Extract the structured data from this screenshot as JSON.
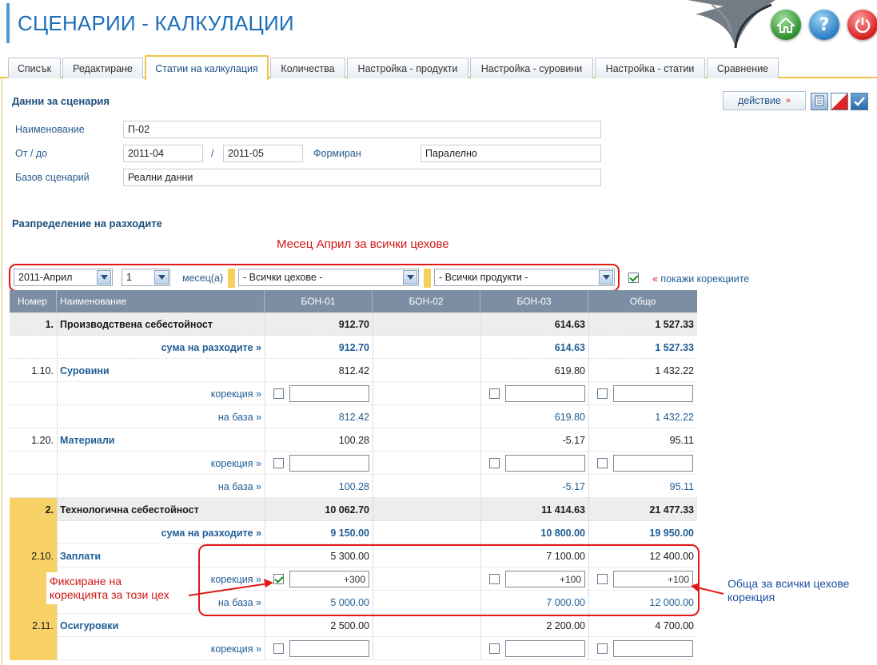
{
  "header": {
    "title": "СЦЕНАРИИ - КАЛКУЛАЦИИ",
    "buttons": [
      "home-icon",
      "help-icon",
      "power-icon"
    ]
  },
  "tabs": [
    {
      "label": "Списък",
      "active": false
    },
    {
      "label": "Редактиране",
      "active": false
    },
    {
      "label": "Статии на калкулация",
      "active": true
    },
    {
      "label": "Количества",
      "active": false
    },
    {
      "label": "Настройка - продукти",
      "active": false
    },
    {
      "label": "Настройка - суровини",
      "active": false
    },
    {
      "label": "Настройка - статии",
      "active": false
    },
    {
      "label": "Сравнение",
      "active": false
    }
  ],
  "scenario": {
    "section_title": "Данни за сценария",
    "action_label": "действие",
    "action_arrows": "»",
    "name_label": "Наименование",
    "name_value": "П-02",
    "period_label": "От / до",
    "from_value": "2011-04",
    "separator": "/",
    "to_value": "2011-05",
    "formed_label": "Формиран",
    "formed_value": "Паралелно",
    "base_label": "Базов сценарий",
    "base_value": "Реални данни"
  },
  "distribution": {
    "section_title": "Разпределение на разходите",
    "annotation_top": "Месец Април за всички цехове",
    "month_select": "2011-Април",
    "count_select": "1",
    "months_label": "месец(а)",
    "workshop_select": "- Всички цехове -",
    "product_select": "- Всички продукти -",
    "show_corrections_checked": true,
    "show_corrections_label": "« покажи корекциите"
  },
  "table": {
    "columns": [
      "Номер",
      "Наименование",
      "БОН-01",
      "БОН-02",
      "БОН-03",
      "Общо"
    ],
    "rows": [
      {
        "type": "group",
        "num": "1.",
        "name": "Производствена себестойност",
        "c1": "912.70",
        "c2": "",
        "c3": "614.63",
        "total": "1 527.33"
      },
      {
        "type": "sum",
        "num": "",
        "name": "сума на разходите »",
        "c1": "912.70",
        "c2": "",
        "c3": "614.63",
        "total": "1 527.33"
      },
      {
        "type": "item",
        "num": "1.10.",
        "name": "Суровини",
        "c1": "812.42",
        "c2": "",
        "c3": "619.80",
        "total": "1 432.22"
      },
      {
        "type": "corr",
        "num": "",
        "name": "корекция »",
        "c1": "",
        "c1_checked": false,
        "c3": "",
        "c3_checked": false,
        "total": "",
        "total_checked": false
      },
      {
        "type": "base",
        "num": "",
        "name": "на база »",
        "c1": "812.42",
        "c2": "",
        "c3": "619.80",
        "total": "1 432.22"
      },
      {
        "type": "item",
        "num": "1.20.",
        "name": "Материали",
        "c1": "100.28",
        "c2": "",
        "c3": "-5.17",
        "total": "95.11"
      },
      {
        "type": "corr",
        "num": "",
        "name": "корекция »",
        "c1": "",
        "c1_checked": false,
        "c3": "",
        "c3_checked": false,
        "total": "",
        "total_checked": false
      },
      {
        "type": "base",
        "num": "",
        "name": "на база »",
        "c1": "100.28",
        "c2": "",
        "c3": "-5.17",
        "total": "95.11"
      },
      {
        "type": "group",
        "num": "2.",
        "name": "Технологична себестойност",
        "c1": "10 062.70",
        "c2": "",
        "c3": "11 414.63",
        "total": "21 477.33"
      },
      {
        "type": "sum",
        "num": "",
        "name": "сума на разходите »",
        "c1": "9 150.00",
        "c2": "",
        "c3": "10 800.00",
        "total": "19 950.00"
      },
      {
        "type": "item",
        "num": "2.10.",
        "name": "Заплати",
        "c1": "5 300.00",
        "c2": "",
        "c3": "7 100.00",
        "total": "12 400.00"
      },
      {
        "type": "corr",
        "num": "",
        "name": "корекция »",
        "c1": "+300",
        "c1_checked": true,
        "c3": "+100",
        "c3_checked": false,
        "total": "+100",
        "total_checked": false
      },
      {
        "type": "base",
        "num": "",
        "name": "на база »",
        "c1": "5 000.00",
        "c2": "",
        "c3": "7 000.00",
        "total": "12 000.00"
      },
      {
        "type": "item",
        "num": "2.11.",
        "name": "Осигуровки",
        "c1": "2 500.00",
        "c2": "",
        "c3": "2 200.00",
        "total": "4 700.00"
      },
      {
        "type": "corr",
        "num": "",
        "name": "корекция »",
        "c1": "",
        "c1_checked": false,
        "c3": "",
        "c3_checked": false,
        "total": "",
        "total_checked": false
      }
    ]
  },
  "annotations": {
    "fix_line1": "Фиксиране на",
    "fix_line2": "корекцията за този цех",
    "total_line1": "Обща за всички цехове",
    "total_line2": "корекция"
  },
  "colors": {
    "accent": "#f0c24b",
    "brand": "#1d6fb8",
    "header_row": "#7b8ea4",
    "annotation": "#e01818"
  }
}
